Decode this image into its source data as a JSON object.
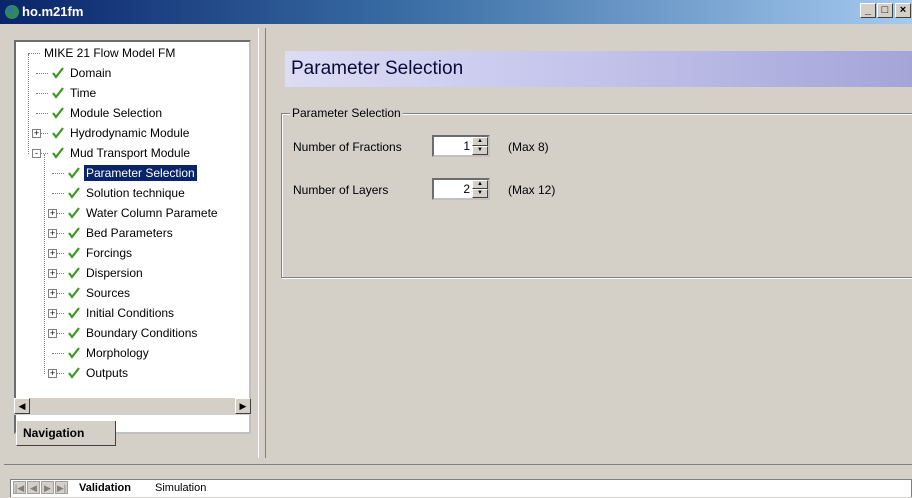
{
  "window": {
    "title": "ho.m21fm",
    "controls": [
      "_",
      "□",
      "×"
    ]
  },
  "navigation": {
    "tab_label": "Navigation",
    "tree": [
      {
        "label": "MIKE 21 Flow Model FM",
        "level": 0,
        "check": false,
        "expander": ""
      },
      {
        "label": "Domain",
        "level": 1,
        "check": true,
        "expander": ""
      },
      {
        "label": "Time",
        "level": 1,
        "check": true,
        "expander": ""
      },
      {
        "label": "Module Selection",
        "level": 1,
        "check": true,
        "expander": ""
      },
      {
        "label": "Hydrodynamic Module",
        "level": 1,
        "check": true,
        "expander": "+"
      },
      {
        "label": "Mud Transport Module",
        "level": 1,
        "check": true,
        "expander": "-"
      },
      {
        "label": "Parameter Selection",
        "level": 2,
        "check": true,
        "expander": "",
        "selected": true
      },
      {
        "label": "Solution technique",
        "level": 2,
        "check": true,
        "expander": ""
      },
      {
        "label": "Water Column Paramete",
        "level": 2,
        "check": true,
        "expander": "+"
      },
      {
        "label": "Bed Parameters",
        "level": 2,
        "check": true,
        "expander": "+"
      },
      {
        "label": "Forcings",
        "level": 2,
        "check": true,
        "expander": "+"
      },
      {
        "label": "Dispersion",
        "level": 2,
        "check": true,
        "expander": "+"
      },
      {
        "label": "Sources",
        "level": 2,
        "check": true,
        "expander": "+"
      },
      {
        "label": "Initial Conditions",
        "level": 2,
        "check": true,
        "expander": "+"
      },
      {
        "label": "Boundary Conditions",
        "level": 2,
        "check": true,
        "expander": "+"
      },
      {
        "label": "Morphology",
        "level": 2,
        "check": true,
        "expander": ""
      },
      {
        "label": "Outputs",
        "level": 2,
        "check": true,
        "expander": "+"
      }
    ]
  },
  "content": {
    "header": "Parameter Selection",
    "group_label": "Parameter Selection",
    "fractions": {
      "label": "Number of Fractions",
      "value": "1",
      "max": "(Max 8)"
    },
    "layers": {
      "label": "Number of Layers",
      "value": "2",
      "max": "(Max 12)"
    }
  },
  "bottom": {
    "tabs": [
      "Validation",
      "Simulation"
    ]
  },
  "colors": {
    "accent": "#0a246a",
    "check": "#3a9a1c",
    "header_bar": "#c8c8ee"
  }
}
